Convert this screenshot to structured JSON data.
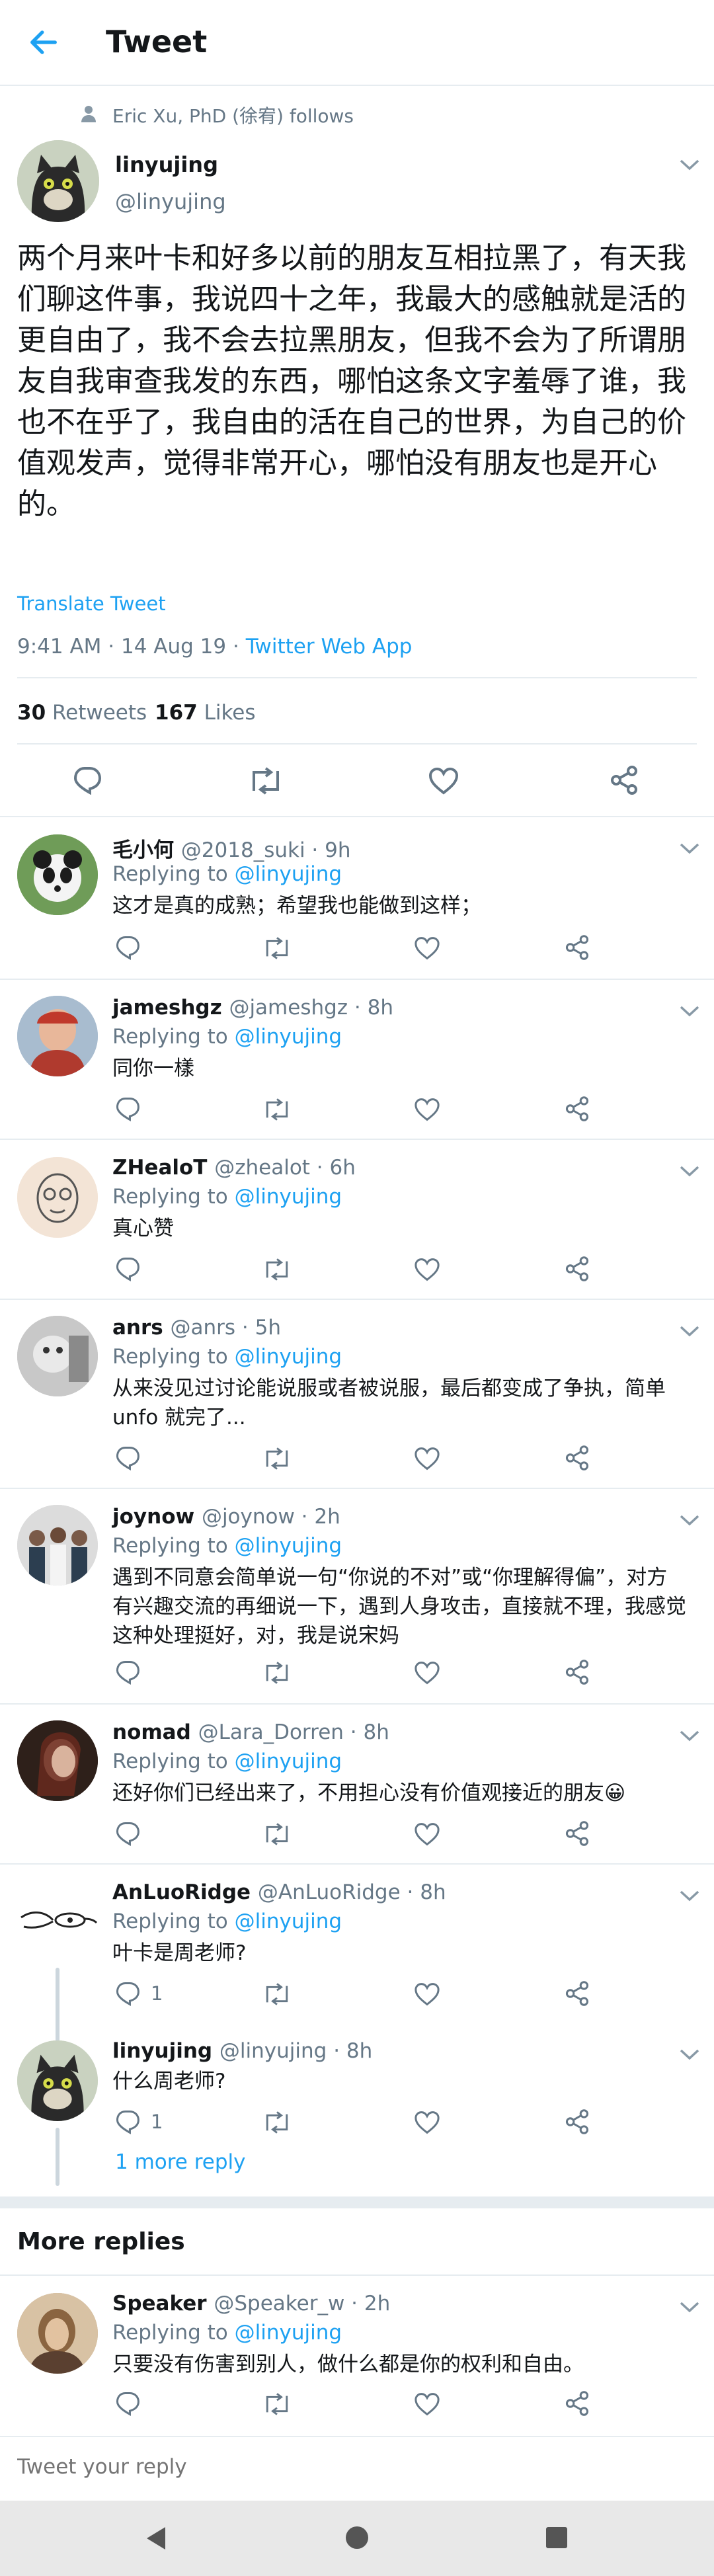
{
  "header": {
    "title": "Tweet"
  },
  "social_context": "Eric Xu, PhD (徐宥) follows",
  "tweet": {
    "name": "linyujing",
    "handle": "@linyujing",
    "text": "两个月来叶卡和好多以前的朋友互相拉黑了，有天我们聊这件事，我说四十之年，我最大的感触就是活的更自由了，我不会去拉黑朋友，但我不会为了所谓朋友自我审查我发的东西，哪怕这条文字羞辱了谁，我也不在乎了，我自由的活在自己的世界，为自己的价值观发声，觉得非常开心，哪怕没有朋友也是开心的。",
    "translate": "Translate Tweet",
    "time": "9:41 AM · 14 Aug 19 · ",
    "client": "Twitter Web App",
    "retweets": "30",
    "retweets_label": "Retweets",
    "likes": "167",
    "likes_label": "Likes"
  },
  "replies": [
    {
      "name": "毛小何",
      "meta": "@2018_suki · 9h",
      "replying": "Replying to ",
      "to": "@linyujing",
      "text": "这才是真的成熟；希望我也能做到这样；",
      "count": ""
    },
    {
      "name": "jameshgz",
      "meta": "@jameshgz · 8h",
      "replying": "Replying to ",
      "to": "@linyujing",
      "text": "同你一樣",
      "count": ""
    },
    {
      "name": "ZHealoT",
      "meta": "@zhealot · 6h",
      "replying": "Replying to ",
      "to": "@linyujing",
      "text": "真心赞",
      "count": ""
    },
    {
      "name": "anrs",
      "meta": "@anrs · 5h",
      "replying": "Replying to ",
      "to": "@linyujing",
      "text": "从来没见过讨论能说服或者被说服，最后都变成了争执，简单unfo 就完了...",
      "count": ""
    },
    {
      "name": "joynow",
      "meta": "@joynow · 2h",
      "replying": "Replying to ",
      "to": "@linyujing",
      "text": "遇到不同意会简单说一句“你说的不对”或“你理解得偏”，对方有兴趣交流的再细说一下，遇到人身攻击，直接就不理，我感觉这种处理挺好，对，我是说宋妈",
      "count": ""
    },
    {
      "name": "nomad",
      "meta": "@Lara_Dorren · 8h",
      "replying": "Replying to ",
      "to": "@linyujing",
      "text": "还好你们已经出来了，不用担心没有价值观接近的朋友😀",
      "count": ""
    },
    {
      "name": "AnLuoRidge",
      "meta": "@AnLuoRidge · 8h",
      "replying": "Replying to ",
      "to": "@linyujing",
      "text": "叶卡是周老师?",
      "count": "1"
    },
    {
      "name": "linyujing",
      "meta": "@linyujing · 8h",
      "replying": "",
      "to": "",
      "text": "什么周老师?",
      "count": "1"
    }
  ],
  "more_reply_link": "1 more reply",
  "more_replies_title": "More replies",
  "more": [
    {
      "name": "Speaker",
      "meta": "@Speaker_w · 2h",
      "replying": "Replying to ",
      "to": "@linyujing",
      "text": "只要没有伤害到别人，做什么都是你的权利和自由。",
      "count": ""
    }
  ],
  "compose_placeholder": "Tweet your reply",
  "colors": {
    "accent": "#1da1f2",
    "secondary_text": "#657786",
    "divider": "#e6ecf0"
  }
}
